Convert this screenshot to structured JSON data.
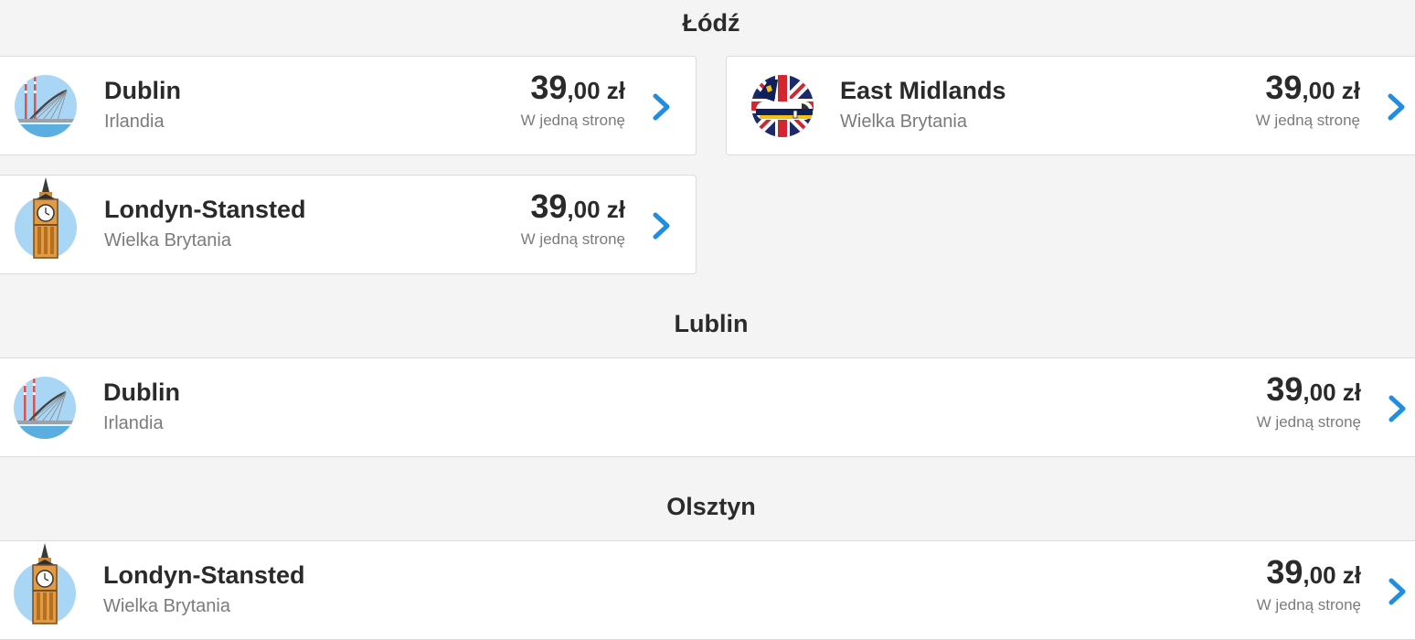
{
  "sections": [
    {
      "title": "Łódź",
      "routes": [
        {
          "city": "Dublin",
          "country": "Irlandia",
          "price_int": "39",
          "price_dec": ",00",
          "currency": " zł",
          "fare_type": "W jedną stronę",
          "icon": "dublin-bridge-icon"
        },
        {
          "city": "East Midlands",
          "country": "Wielka Brytania",
          "price_int": "39",
          "price_dec": ",00",
          "currency": " zł",
          "fare_type": "W jedną stronę",
          "icon": "ryanair-plane-uk-flag-icon"
        },
        {
          "city": "Londyn-Stansted",
          "country": "Wielka Brytania",
          "price_int": "39",
          "price_dec": ",00",
          "currency": " zł",
          "fare_type": "W jedną stronę",
          "icon": "big-ben-icon"
        }
      ]
    },
    {
      "title": "Lublin",
      "routes": [
        {
          "city": "Dublin",
          "country": "Irlandia",
          "price_int": "39",
          "price_dec": ",00",
          "currency": " zł",
          "fare_type": "W jedną stronę",
          "icon": "dublin-bridge-icon"
        }
      ]
    },
    {
      "title": "Olsztyn",
      "routes": [
        {
          "city": "Londyn-Stansted",
          "country": "Wielka Brytania",
          "price_int": "39",
          "price_dec": ",00",
          "currency": " zł",
          "fare_type": "W jedną stronę",
          "icon": "big-ben-icon"
        }
      ]
    }
  ],
  "colors": {
    "background": "#f4f4f4",
    "card": "#ffffff",
    "chevron": "#1f8ee0",
    "icon_circle": "#a9d6f5"
  }
}
